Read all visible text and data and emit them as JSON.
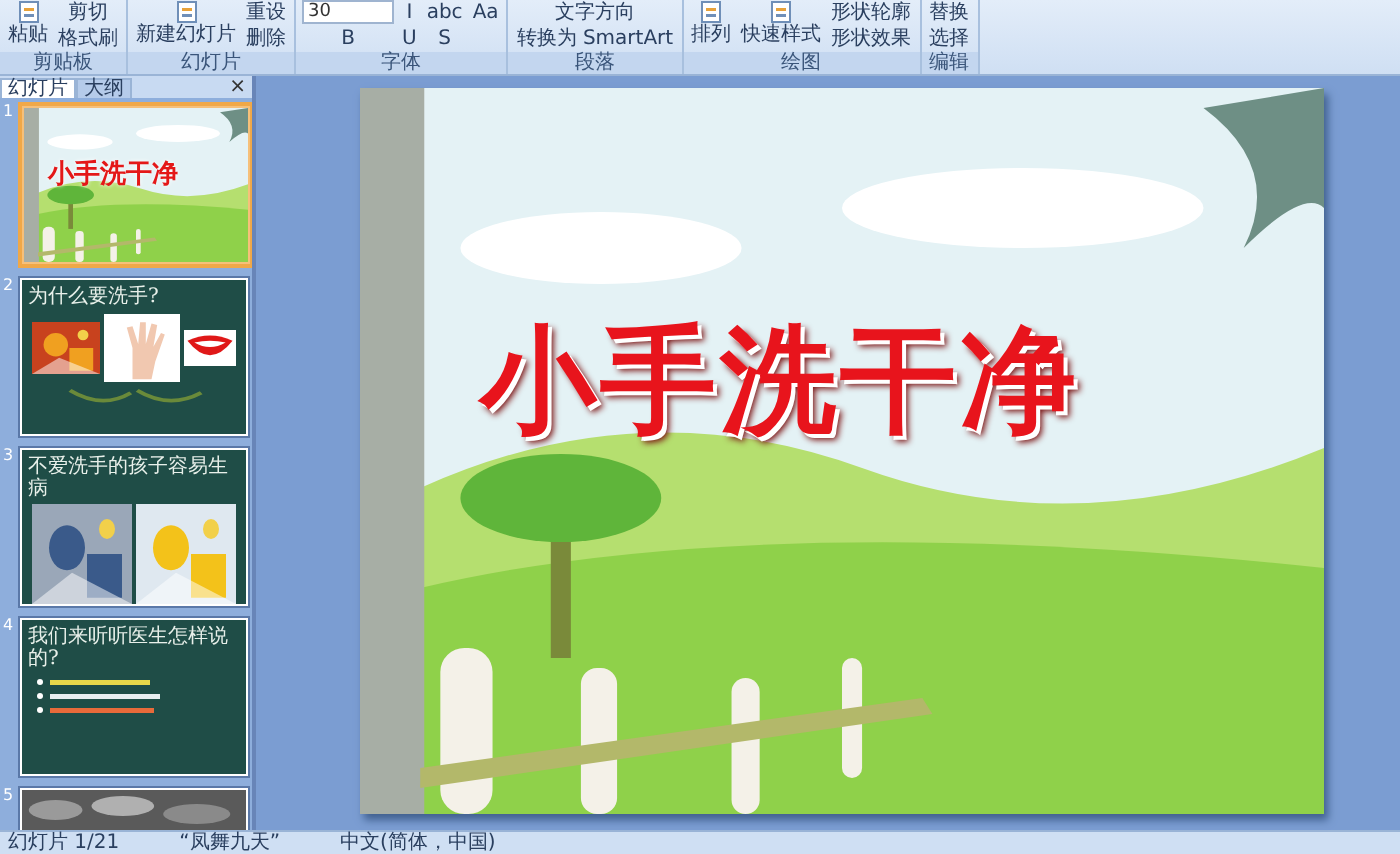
{
  "ribbon": {
    "groups": [
      {
        "label": "剪贴板",
        "items": [
          {
            "label": "粘贴",
            "kind": "large"
          },
          {
            "label": "剪切",
            "kind": "small"
          },
          {
            "label": "格式刷",
            "kind": "small"
          }
        ]
      },
      {
        "label": "幻灯片",
        "items": [
          {
            "label": "新建幻灯片",
            "kind": "large"
          },
          {
            "label": "重设",
            "kind": "small"
          },
          {
            "label": "删除",
            "kind": "small"
          }
        ]
      },
      {
        "label": "字体",
        "items": [
          {
            "label": "30",
            "kind": "field"
          },
          {
            "label": "B",
            "kind": "small"
          },
          {
            "label": "I",
            "kind": "small"
          },
          {
            "label": "U",
            "kind": "small"
          },
          {
            "label": "abc",
            "kind": "small"
          },
          {
            "label": "S",
            "kind": "small"
          },
          {
            "label": "Aa",
            "kind": "small"
          }
        ]
      },
      {
        "label": "段落",
        "items": [
          {
            "label": "文字方向",
            "kind": "small"
          },
          {
            "label": "转换为 SmartArt",
            "kind": "small"
          }
        ]
      },
      {
        "label": "绘图",
        "items": [
          {
            "label": "排列",
            "kind": "large"
          },
          {
            "label": "快速样式",
            "kind": "large"
          },
          {
            "label": "形状轮廓",
            "kind": "small"
          },
          {
            "label": "形状效果",
            "kind": "small"
          }
        ]
      },
      {
        "label": "编辑",
        "items": [
          {
            "label": "替换",
            "kind": "small"
          },
          {
            "label": "选择",
            "kind": "small"
          }
        ]
      }
    ]
  },
  "panel": {
    "tabs": [
      {
        "label": "幻灯片",
        "selected": true
      },
      {
        "label": "大纲",
        "selected": false
      }
    ],
    "close": "×"
  },
  "slides": [
    {
      "number": "1",
      "selected": true,
      "kind": "cover",
      "title": "小手洗干净"
    },
    {
      "number": "2",
      "selected": false,
      "kind": "pictures",
      "title": "为什么要洗手?"
    },
    {
      "number": "3",
      "selected": false,
      "kind": "photos",
      "title": "不爱洗手的孩子容易生病"
    },
    {
      "number": "4",
      "selected": false,
      "kind": "bullets",
      "title": "我们来听听医生怎样说的?"
    },
    {
      "number": "5",
      "selected": false,
      "kind": "partial"
    }
  ],
  "slide": {
    "title": "小手洗干净"
  },
  "status_bar": [
    "幻灯片 1/21",
    "“凤舞九天”",
    "中文(简体，中国)"
  ]
}
